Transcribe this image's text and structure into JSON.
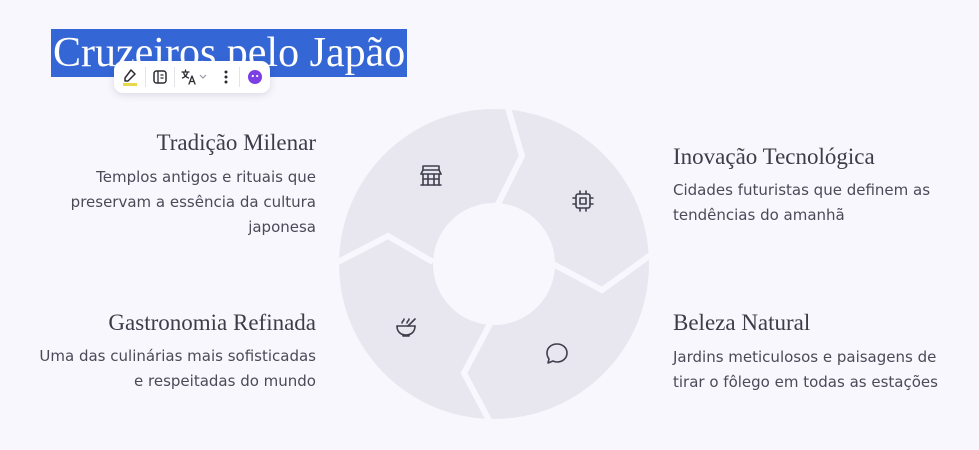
{
  "title": "Cruzeiros pelo Japão",
  "toolbar": {
    "buttons": [
      "highlighter-icon",
      "notes-icon",
      "translate-icon",
      "more-icon",
      "assistant-icon"
    ]
  },
  "colors": {
    "selection": "#3466d6",
    "segment_fill": "#e8e7f0",
    "background": "#f8f7fd",
    "icon_stroke": "#3f3e4c"
  },
  "blocks": {
    "tradicao": {
      "title": "Tradição Milenar",
      "lines": [
        "Templos antigos e rituais que",
        "preservam a essência da cultura",
        "japonesa"
      ],
      "icon": "temple-icon"
    },
    "inovacao": {
      "title": "Inovação Tecnológica",
      "lines": [
        "Cidades futuristas que definem as",
        "tendências do amanhã"
      ],
      "icon": "chip-icon"
    },
    "gastronomia": {
      "title": "Gastronomia Refinada",
      "lines": [
        "Uma das culinárias mais sofisticadas",
        "e respeitadas do mundo"
      ],
      "icon": "bowl-icon"
    },
    "beleza": {
      "title": "Beleza Natural",
      "lines": [
        "Jardins meticulosos e paisagens de",
        "tirar o fôlego em todas as estações"
      ],
      "icon": "speech-bubble-icon"
    }
  }
}
